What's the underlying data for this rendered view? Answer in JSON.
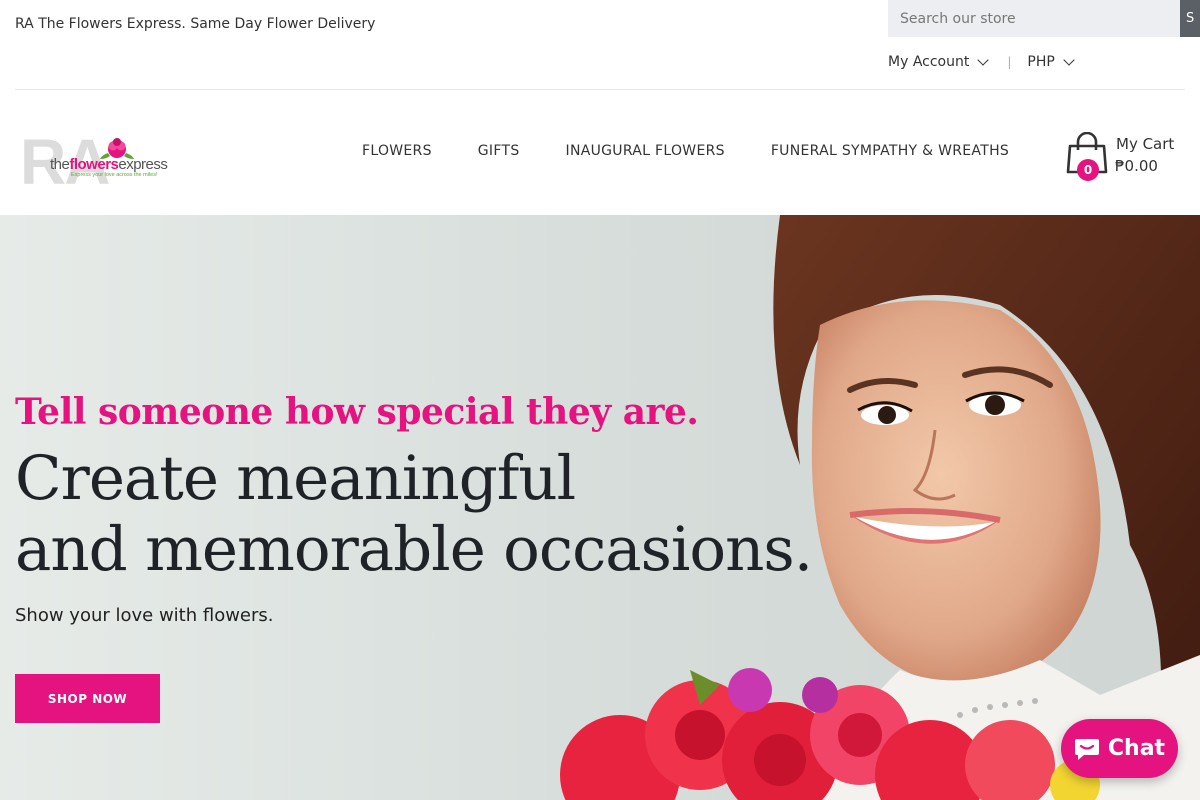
{
  "topbar": {
    "tagline": "RA The Flowers Express. Same Day Flower Delivery",
    "search_placeholder": "Search our store",
    "search_button": "S",
    "account_label": "My Account",
    "currency_label": "PHP",
    "separator": "|"
  },
  "header": {
    "logo": {
      "initials": "RA",
      "brand_prefix": "the",
      "brand_bold": "flowers",
      "brand_suffix": "express",
      "slogan": "Express your love across the miles!"
    },
    "nav": [
      "FLOWERS",
      "GIFTS",
      "INAUGURAL FLOWERS",
      "FUNERAL SYMPATHY & WREATHS"
    ],
    "cart": {
      "label": "My Cart",
      "total": "₱0.00",
      "count": "0"
    }
  },
  "hero": {
    "subtitle": "Tell someone how special they are.",
    "title_line1": "Create meaningful",
    "title_line2": "and memorable occasions.",
    "text": "Show your love with flowers.",
    "button": "SHOP NOW"
  },
  "chat": {
    "label": "Chat"
  },
  "colors": {
    "accent": "#e4137f",
    "text": "#1f2328",
    "search_bg": "#eceef1"
  },
  "icons": [
    "chevron-down-icon",
    "cart-bag-icon",
    "chat-bubble-icon"
  ]
}
